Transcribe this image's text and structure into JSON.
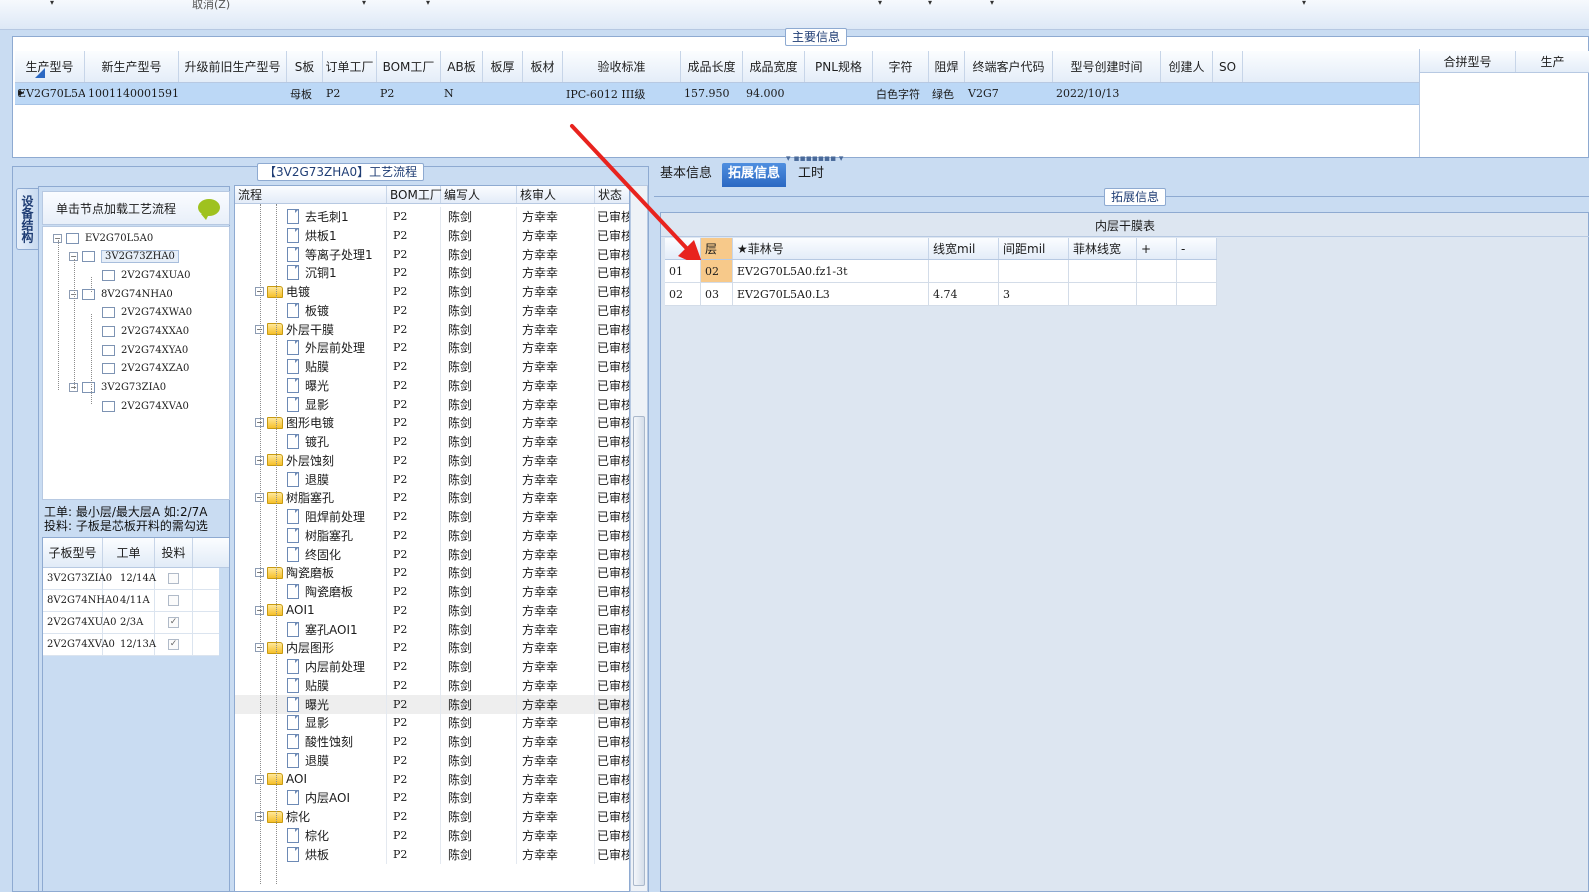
{
  "toolbar": {
    "cancel_label": "取消(Z)"
  },
  "main_info": {
    "title": "主要信息",
    "columns": [
      "生产型号",
      "新生产型号",
      "升级前旧生产型号",
      "S板",
      "订单工厂",
      "BOM工厂",
      "AB板",
      "板厚",
      "板材",
      "验收标准",
      "成品长度",
      "成品宽度",
      "PNL规格",
      "字符",
      "阻焊",
      "终端客户代码",
      "型号创建时间",
      "创建人",
      "SO"
    ],
    "row": [
      "EV2G70L5A0",
      "10011400015911",
      "",
      "母板",
      "P2",
      "P2",
      "N",
      "",
      "",
      "IPC-6012 III级",
      "157.950",
      "94.000",
      "",
      "白色字符",
      "绿色",
      "V2G7",
      "2022/10/13",
      "",
      ""
    ],
    "side_columns": [
      "合拼型号",
      "生产"
    ]
  },
  "process_panel": {
    "title": "【3V2G73ZHA0】工艺流程",
    "side_tab": "设备结构",
    "hint": "单击节点加载工艺流程",
    "tree": [
      {
        "label": "EV2G70L5A0"
      },
      {
        "label": "3V2G73ZHA0"
      },
      {
        "label": "2V2G74XUA0"
      },
      {
        "label": "8V2G74NHA0"
      },
      {
        "label": "2V2G74XWA0"
      },
      {
        "label": "2V2G74XXA0"
      },
      {
        "label": "2V2G74XYA0"
      },
      {
        "label": "2V2G74XZA0"
      },
      {
        "label": "3V2G73ZIA0"
      },
      {
        "label": "2V2G74XVA0"
      }
    ],
    "legend_line1": "工单: 最小层/最大层A 如:2/7A",
    "legend_line2": "投料: 子板是芯板开料的需勾选",
    "sub_table": {
      "columns": [
        "子板型号",
        "工单",
        "投料"
      ],
      "rows": [
        {
          "model": "3V2G73ZIA0",
          "order": "12/14A",
          "checked": false
        },
        {
          "model": "8V2G74NHA0",
          "order": "4/11A",
          "checked": false
        },
        {
          "model": "2V2G74XUA0",
          "order": "2/3A",
          "checked": true
        },
        {
          "model": "2V2G74XVA0",
          "order": "12/13A",
          "checked": true
        }
      ]
    }
  },
  "process_grid": {
    "columns": [
      "流程",
      "BOM工厂",
      "编写人",
      "核审人",
      "状态"
    ],
    "rows": [
      {
        "name": "去毛刺1",
        "type": "doc"
      },
      {
        "name": "烘板1",
        "type": "doc"
      },
      {
        "name": "等离子处理1",
        "type": "doc"
      },
      {
        "name": "沉铜1",
        "type": "doc"
      },
      {
        "name": "电镀",
        "type": "folder"
      },
      {
        "name": "板镀",
        "type": "doc"
      },
      {
        "name": "外层干膜",
        "type": "folder"
      },
      {
        "name": "外层前处理",
        "type": "doc"
      },
      {
        "name": "贴膜",
        "type": "doc"
      },
      {
        "name": "曝光",
        "type": "doc"
      },
      {
        "name": "显影",
        "type": "doc"
      },
      {
        "name": "图形电镀",
        "type": "folder"
      },
      {
        "name": "镀孔",
        "type": "doc"
      },
      {
        "name": "外层蚀刻",
        "type": "folder"
      },
      {
        "name": "退膜",
        "type": "doc"
      },
      {
        "name": "树脂塞孔",
        "type": "folder"
      },
      {
        "name": "阻焊前处理",
        "type": "doc"
      },
      {
        "name": "树脂塞孔",
        "type": "doc"
      },
      {
        "name": "终固化",
        "type": "doc"
      },
      {
        "name": "陶瓷磨板",
        "type": "folder"
      },
      {
        "name": "陶瓷磨板",
        "type": "doc"
      },
      {
        "name": "AOI1",
        "type": "folder"
      },
      {
        "name": "塞孔AOI1",
        "type": "doc"
      },
      {
        "name": "内层图形",
        "type": "folder"
      },
      {
        "name": "内层前处理",
        "type": "doc"
      },
      {
        "name": "贴膜",
        "type": "doc"
      },
      {
        "name": "曝光",
        "type": "doc",
        "highlight": true
      },
      {
        "name": "显影",
        "type": "doc"
      },
      {
        "name": "酸性蚀刻",
        "type": "doc"
      },
      {
        "name": "退膜",
        "type": "doc"
      },
      {
        "name": "AOI",
        "type": "folder"
      },
      {
        "name": "内层AOI",
        "type": "doc"
      },
      {
        "name": "棕化",
        "type": "folder"
      },
      {
        "name": "棕化",
        "type": "doc"
      },
      {
        "name": "烘板",
        "type": "doc"
      }
    ],
    "bom": "P2",
    "writer": "陈剑",
    "reviewer": "方幸幸",
    "status": "已审核"
  },
  "right_panel": {
    "tabs": [
      "基本信息",
      "拓展信息",
      "工时"
    ],
    "active_tab": 1,
    "group_title": "拓展信息",
    "film_table_title": "内层干膜表",
    "film_columns": [
      "层",
      "★菲林号",
      "线宽mil",
      "间距mil",
      "菲林线宽",
      "+",
      "-"
    ],
    "film_rows": [
      {
        "idx": "01",
        "layer": "02",
        "film": "EV2G70L5A0.fz1-3t",
        "width": "",
        "spacing": "",
        "film_width": ""
      },
      {
        "idx": "02",
        "layer": "03",
        "film": "EV2G70L5A0.L3",
        "width": "4.74",
        "spacing": "3",
        "film_width": ""
      }
    ]
  },
  "colors": {
    "accent": "#2b68c2",
    "selection": "#bcd8f6",
    "arrow": "#e8231e",
    "highlight_cell": "#f7c98a"
  }
}
